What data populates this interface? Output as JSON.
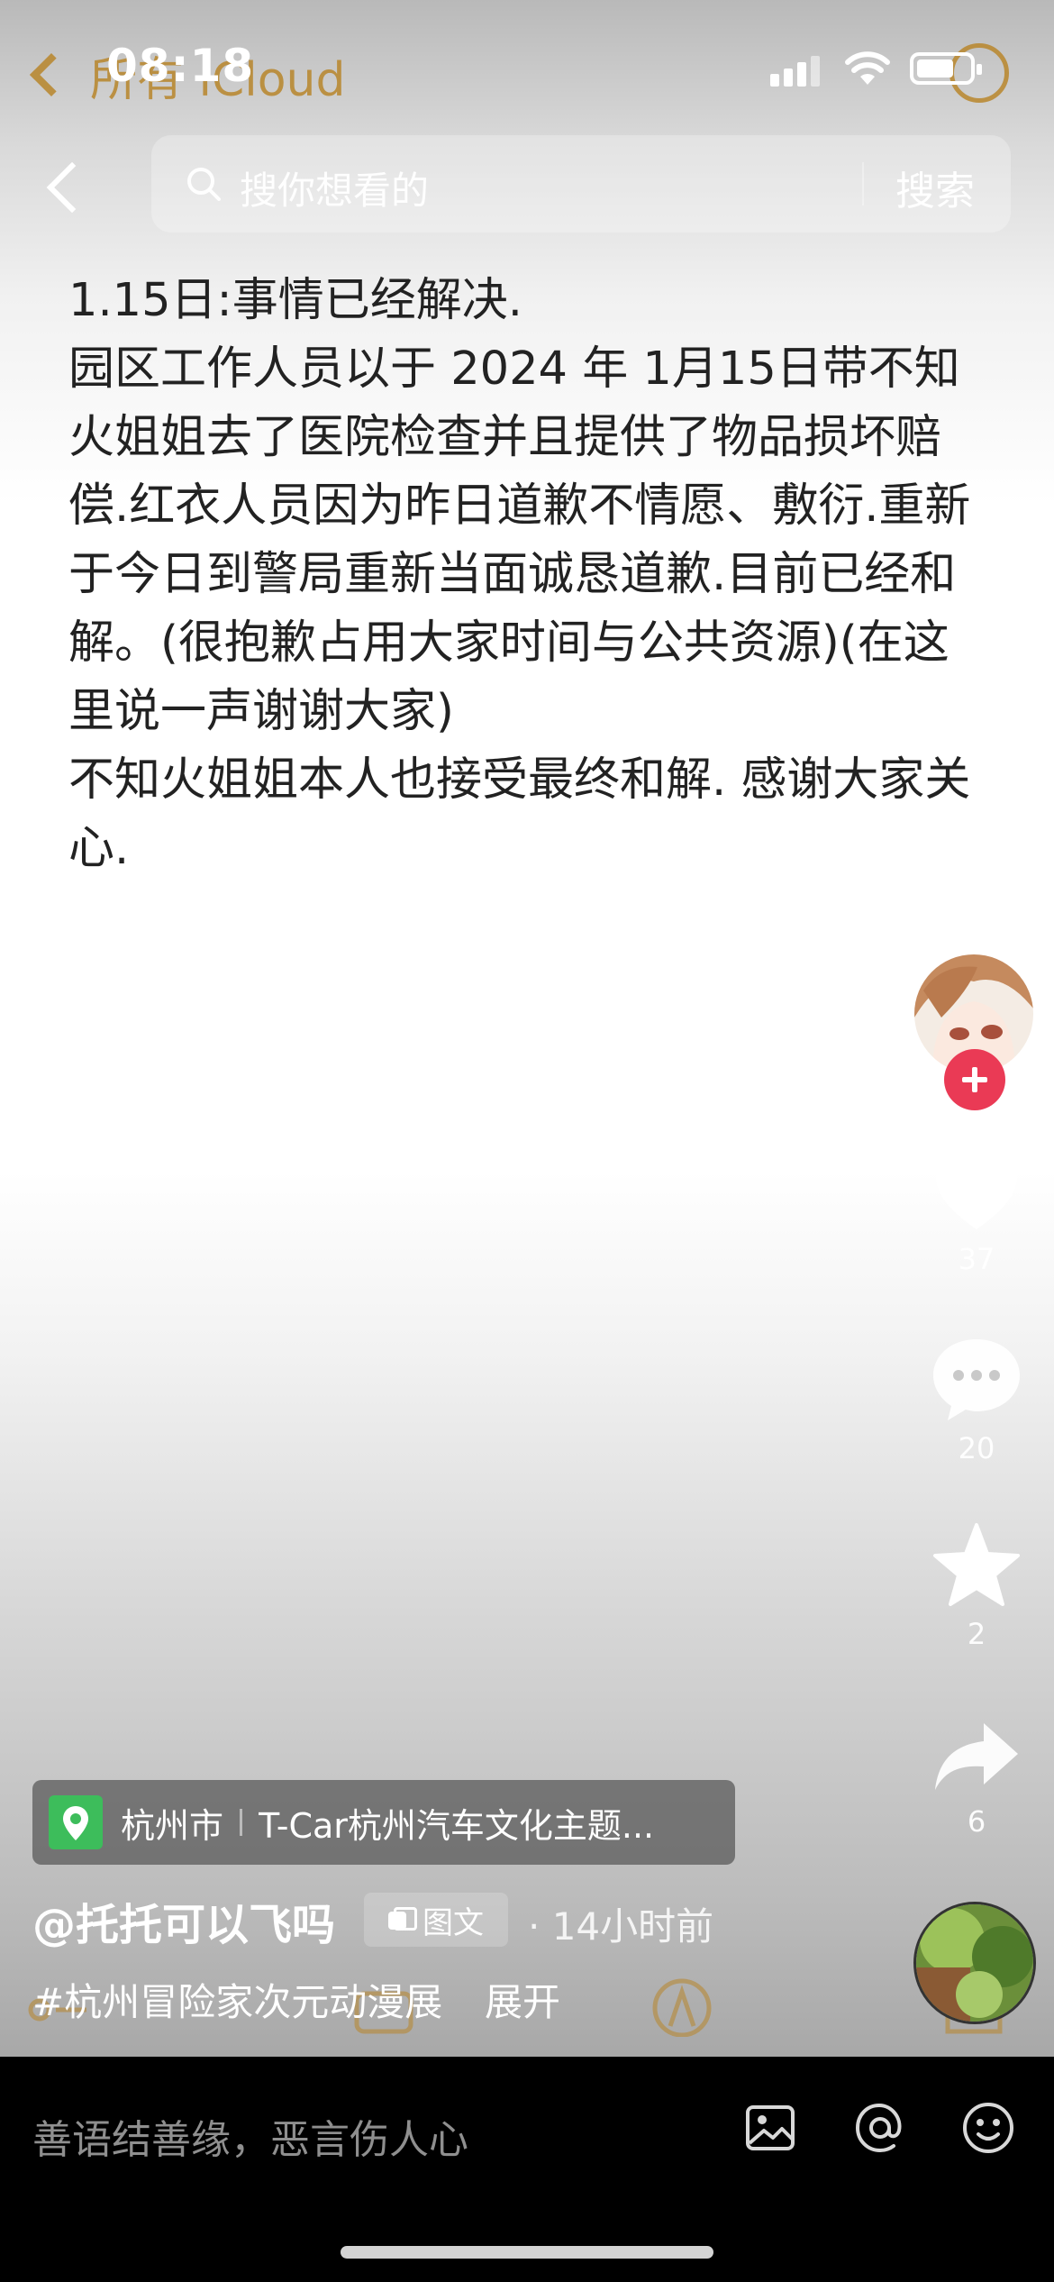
{
  "status_bar": {
    "time": "08:18"
  },
  "background_app": {
    "back_label": "所有 iCloud"
  },
  "search": {
    "placeholder": "搜你想看的",
    "button_label": "搜索"
  },
  "post": {
    "paragraphs": [
      "1.15日:事情已经解决.",
      "园区工作人员以于 2024 年 1月15日带不知火姐姐去了医院检查并且提供了物品损坏赔偿.红衣人员因为昨日道歉不情愿、敷衍.重新于今日到警局重新当面诚恳道歉.目前已经和解。(很抱歉占用大家时间与公共资源)(在这里说一声谢谢大家)",
      "不知火姐姐本人也接受最终和解. 感谢大家关心."
    ]
  },
  "actions": {
    "likes": "37",
    "comments": "20",
    "favorites": "2",
    "shares": "6"
  },
  "location": {
    "city": "杭州市",
    "venue": "T-Car杭州汽车文化主题..."
  },
  "author": {
    "handle": "@托托可以飞吗"
  },
  "post_type": "图文",
  "post_time": "· 14小时前",
  "hashtag": "#杭州冒险家次元动漫展",
  "expand_label": "展开",
  "comment": {
    "placeholder": "善语结善缘，恶言伤人心"
  },
  "colors": {
    "follow": "#ea3a55",
    "location": "#3dbd5b",
    "ghost_accent": "#b8862b"
  }
}
